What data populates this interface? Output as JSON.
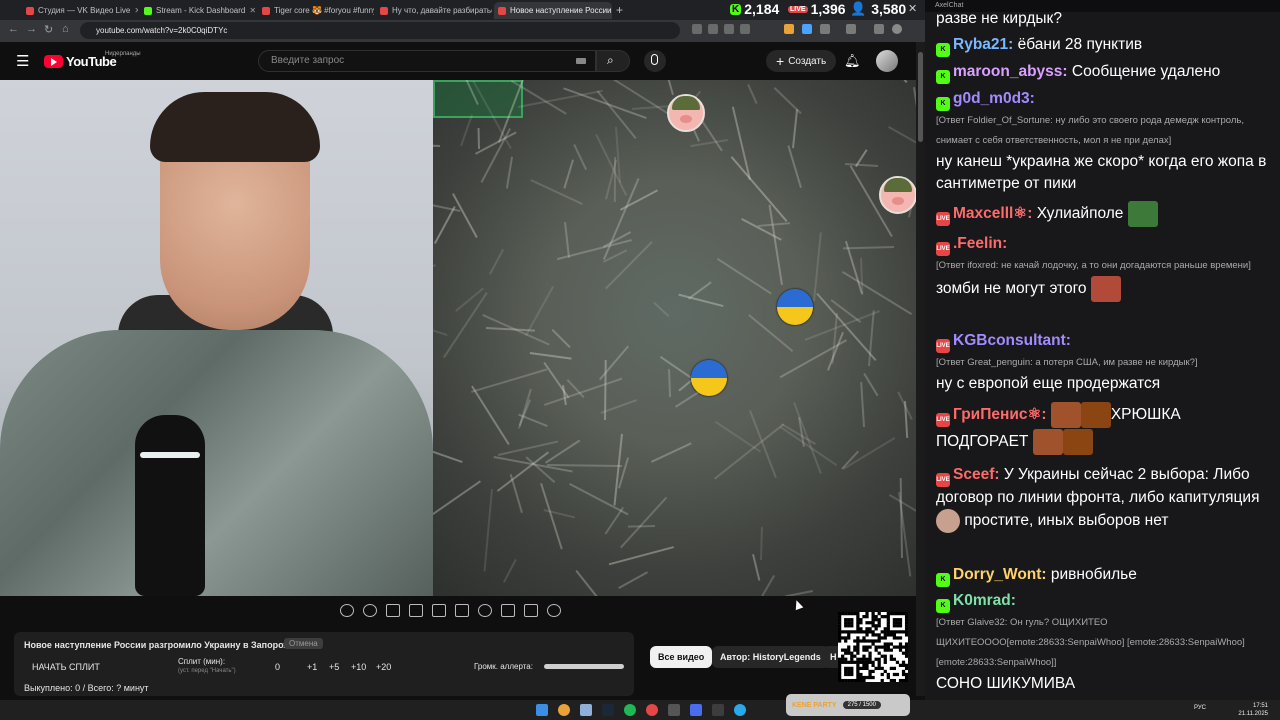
{
  "browser": {
    "tabs": [
      {
        "title": "Студия — VK Видео Live",
        "color": "#e64646"
      },
      {
        "title": "Stream - Kick Dashboard",
        "color": "#53fc18"
      },
      {
        "title": "Tiger core 🐯 #foryou #funny #",
        "color": "#e64646"
      },
      {
        "title": "Ну что, давайте разбираться",
        "color": "#e64646"
      },
      {
        "title": "Новое наступление России ра",
        "color": "#e64646"
      }
    ],
    "new_tab": "+",
    "url": "youtube.com/watch?v=2k0C0qiDTYc"
  },
  "counters": {
    "kick": "2,184",
    "vk": "1,396",
    "viewers": "3,580"
  },
  "youtube": {
    "logo": "YouTube",
    "region": "Нидерланды",
    "search_placeholder": "Введите запрос",
    "create_label": "Создать"
  },
  "overlay": {
    "title": "Новое наступление России разгромило Украину в Запорожье",
    "tag": "Отмена",
    "start_split": "НАЧАТЬ СПЛИТ",
    "split_label": "Сплит (мин):",
    "split_hint": "(уст. перед \"Начать\")",
    "split_value": "0",
    "increments": [
      "+1",
      "+5",
      "+10",
      "+20"
    ],
    "volume_label": "Громк. аллерта:",
    "bought": "Выкуплено: 0 / Всего: ? минут"
  },
  "filters": {
    "all": "Все видео",
    "author": "Автор: HistoryLegends",
    "more": "Н"
  },
  "chat": {
    "window_title": "AxelChat",
    "messages": [
      {
        "text": "разве не кирдык?"
      },
      {
        "platform": "kick",
        "user": "Ryba21:",
        "color": "#7ab8ff",
        "text": "ёбани 28 пунктив"
      },
      {
        "platform": "kick",
        "user": "maroon_abyss:",
        "color": "#d9a0ff",
        "text": "Сообщение удалено"
      },
      {
        "platform": "kick",
        "user": "g0d_m0d3:",
        "color": "#a38bff",
        "reply": "[Ответ Foldier_Of_Sortune: ну либо это своего рода демедж контроль, снимает с себя ответственность, мол я не при делах]",
        "text": "ну канеш *украина же скоро* когда его жопа в сантиметре от пики"
      },
      {
        "platform": "vk",
        "user": "Maxcelll⚛:",
        "color": "#ff6a6a",
        "text": "Хулиайполе"
      },
      {
        "platform": "vk",
        "user": ".Feelin:",
        "color": "#ff6a6a",
        "reply": "[Ответ ifoxred: не качай лодочку, а то они догадаются раньше времени]",
        "text": "зомби не могут этого"
      },
      {
        "platform": "vk",
        "user": "KGBconsultant:",
        "color": "#a38bff",
        "reply": "[Ответ Great_penguin: а потеря США, им разве не кирдык?]",
        "text": "ну с европой еще продержатся"
      },
      {
        "platform": "vk",
        "user": "ГриПенис⚛:",
        "color": "#ff6a6a",
        "text": "ХРЮШКА",
        "text2": "ПОДГОРАЕТ"
      },
      {
        "platform": "vk",
        "user": "Sceef:",
        "color": "#ff6a6a",
        "text": "У Украины сейчас 2 выбора: Либо договор по линии фронта, либо капитуляция",
        "text2": "простите, иных выборов нет"
      },
      {
        "platform": "kick",
        "user": "Dorry_Wont:",
        "color": "#ffd36a",
        "text": "ривнобилье"
      },
      {
        "platform": "kick",
        "user": "K0mrad:",
        "color": "#7fe0a8",
        "reply": "[Ответ Glaive32: Он гуль? ОЩИХИТЕО ЩИХИТЕОООО[emote:28633:SenpaiWhoo] [emote:28633:SenpaiWhoo][emote:28633:SenpaiWhoo]]",
        "text": "СОНО ШИКУМИВА"
      }
    ]
  },
  "taskbar": {
    "lang": "РУС",
    "time": "17:51",
    "date": "21.11.2025",
    "party": "KENE PARTY",
    "party_count": "275 / 1500"
  }
}
